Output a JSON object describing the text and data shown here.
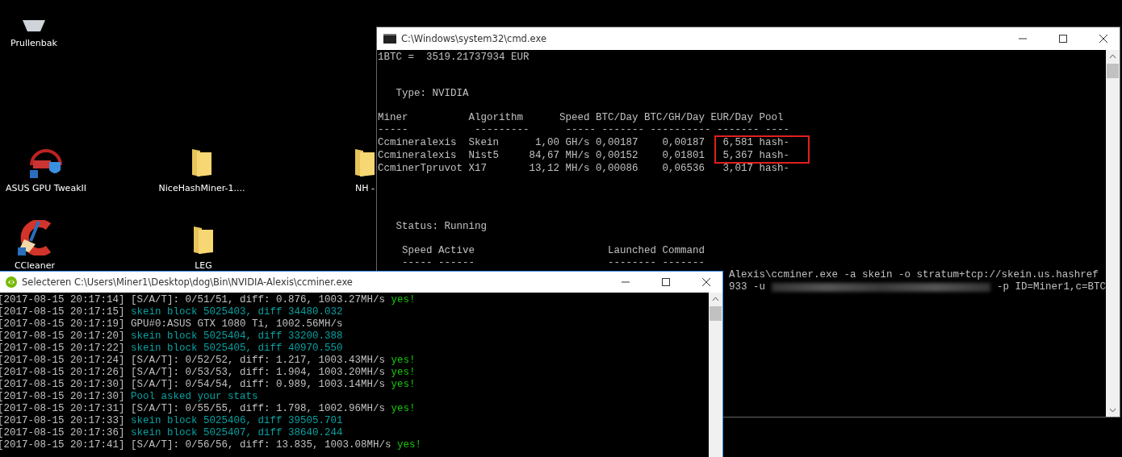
{
  "desktop_icons": [
    {
      "kind": "bin",
      "label": "Prullenbak"
    },
    {
      "kind": "gpu",
      "label": "ASUS GPU TweakII"
    },
    {
      "kind": "folder",
      "label": "NiceHashMiner-1...."
    },
    {
      "kind": "folder",
      "label": "NH -"
    },
    {
      "kind": "ccleaner",
      "label": "CCleaner"
    },
    {
      "kind": "folder",
      "label": "LEG"
    }
  ],
  "cmd_window": {
    "title": "C:\\Windows\\system32\\cmd.exe",
    "rate_line": "1BTC =  3519.21737934 EUR",
    "type_line": "Type: NVIDIA",
    "table": {
      "columns": [
        "Miner",
        "Algorithm",
        "Speed",
        "BTC/Day",
        "BTC/GH/Day",
        "EUR/Day",
        "Pool"
      ],
      "rule": "-----           ---------      ----- ------- ---------- ------- ----",
      "rows": [
        {
          "miner": "Ccmineralexis",
          "algorithm": "Skein",
          "speed": "1,00 GH/s",
          "btc_day": "0,00187",
          "btc_gh_day": "0,00187",
          "eur_day": "6,581",
          "pool": "hash-"
        },
        {
          "miner": "Ccmineralexis",
          "algorithm": "Nist5",
          "speed": "84,67 MH/s",
          "btc_day": "0,00152",
          "btc_gh_day": "0,01801",
          "eur_day": "5,367",
          "pool": "hash-"
        },
        {
          "miner": "CcminerTpruvot",
          "algorithm": "X17",
          "speed": "13,12 MH/s",
          "btc_day": "0,00086",
          "btc_gh_day": "0,06536",
          "eur_day": "3,017",
          "pool": "hash-"
        }
      ]
    },
    "status_line": "Status: Running",
    "speed_active": {
      "heading": "Speed Active",
      "rule": "----- ------"
    },
    "launched_command": {
      "heading": "Launched Command",
      "rule": "-------- -------"
    },
    "command_line_1": "Alexis\\ccminer.exe -a skein -o stratum+tcp://skein.us.hashref",
    "command_line_2_start": "933 -u",
    "command_line_2_end": "-p ID=Miner1,c=BTC"
  },
  "ccminer_window": {
    "title": "Selecteren C:\\Users\\Miner1\\Desktop\\dog\\Bin\\NVIDIA-Alexis\\ccminer.exe",
    "lines": [
      {
        "kind": "share",
        "time": "[2017-08-15 20:17:14]",
        "text": "[S/A/T]: 0/51/51, diff: 0.876, 1003.27MH/s",
        "result": "yes!"
      },
      {
        "kind": "info",
        "time": "[2017-08-15 20:17:15]",
        "text": "skein block 5025403, diff 34480.032"
      },
      {
        "kind": "plain",
        "time": "[2017-08-15 20:17:19]",
        "text": "GPU#0:ASUS GTX 1080 Ti, 1002.56MH/s"
      },
      {
        "kind": "info",
        "time": "[2017-08-15 20:17:20]",
        "text": "skein block 5025404, diff 33200.388"
      },
      {
        "kind": "info",
        "time": "[2017-08-15 20:17:22]",
        "text": "skein block 5025405, diff 40970.550"
      },
      {
        "kind": "share",
        "time": "[2017-08-15 20:17:24]",
        "text": "[S/A/T]: 0/52/52, diff: 1.217, 1003.43MH/s",
        "result": "yes!"
      },
      {
        "kind": "share",
        "time": "[2017-08-15 20:17:26]",
        "text": "[S/A/T]: 0/53/53, diff: 1.904, 1003.20MH/s",
        "result": "yes!"
      },
      {
        "kind": "share",
        "time": "[2017-08-15 20:17:30]",
        "text": "[S/A/T]: 0/54/54, diff: 0.989, 1003.14MH/s",
        "result": "yes!"
      },
      {
        "kind": "info",
        "time": "[2017-08-15 20:17:30]",
        "text": "Pool asked your stats"
      },
      {
        "kind": "share",
        "time": "[2017-08-15 20:17:31]",
        "text": "[S/A/T]: 0/55/55, diff: 1.798, 1002.96MH/s",
        "result": "yes!"
      },
      {
        "kind": "info",
        "time": "[2017-08-15 20:17:33]",
        "text": "skein block 5025406, diff 39505.701"
      },
      {
        "kind": "info",
        "time": "[2017-08-15 20:17:36]",
        "text": "skein block 5025407, diff 38640.244"
      },
      {
        "kind": "share",
        "time": "[2017-08-15 20:17:41]",
        "text": "[S/A/T]: 0/56/56, diff: 13.835, 1003.08MH/s",
        "result": "yes!"
      }
    ]
  }
}
